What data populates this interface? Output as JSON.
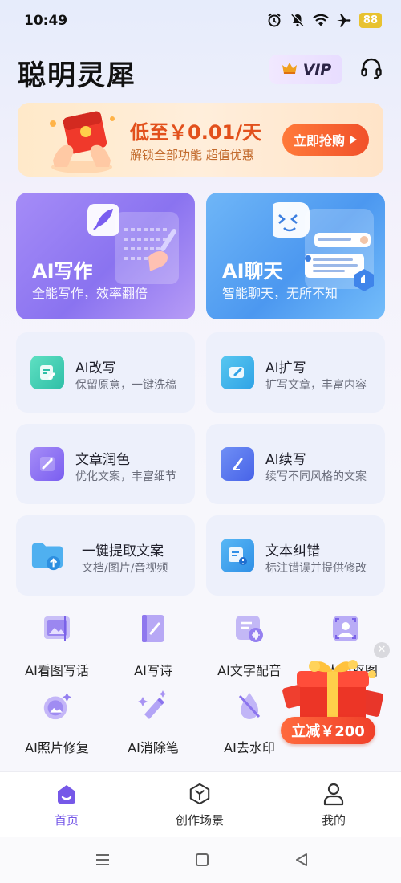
{
  "status_bar": {
    "time": "10:49",
    "battery": "88",
    "icons": [
      "alarm-icon",
      "mute-icon",
      "wifi-icon",
      "airplane-icon",
      "battery-icon"
    ]
  },
  "header": {
    "title": "聪明灵犀",
    "vip_label": "VIP"
  },
  "promo": {
    "title": "低至￥0.01/天",
    "subtitle": "解锁全部功能 超值优惠",
    "button": "立即抢购"
  },
  "big_cards": [
    {
      "title": "AI写作",
      "subtitle": "全能写作，效率翻倍"
    },
    {
      "title": "AI聊天",
      "subtitle": "智能聊天，无所不知"
    }
  ],
  "features": [
    {
      "title": "AI改写",
      "subtitle": "保留原意，一键洗稿"
    },
    {
      "title": "AI扩写",
      "subtitle": "扩写文章，丰富内容"
    },
    {
      "title": "文章润色",
      "subtitle": "优化文案，丰富细节"
    },
    {
      "title": "AI续写",
      "subtitle": "续写不同风格的文案"
    },
    {
      "title": "一键提取文案",
      "subtitle": "文档/图片/音视频"
    },
    {
      "title": "文本纠错",
      "subtitle": "标注错误并提供修改"
    }
  ],
  "tools": [
    {
      "label": "AI看图写话",
      "icon": "image-write-icon"
    },
    {
      "label": "AI写诗",
      "icon": "poem-icon"
    },
    {
      "label": "AI文字配音",
      "icon": "voice-icon"
    },
    {
      "label": "AI人像抠图",
      "icon": "portrait-icon"
    },
    {
      "label": "AI照片修复",
      "icon": "photo-repair-icon"
    },
    {
      "label": "AI消除笔",
      "icon": "eraser-icon"
    },
    {
      "label": "AI去水印",
      "icon": "watermark-icon"
    }
  ],
  "floating_coupon": {
    "label": "立减￥200"
  },
  "bottom_nav": [
    {
      "label": "首页",
      "active": true
    },
    {
      "label": "创作场景",
      "active": false
    },
    {
      "label": "我的",
      "active": false
    }
  ],
  "colors": {
    "accent": "#7658e8",
    "promo_orange": "#e2501c",
    "card_bg": "#edf0fb"
  }
}
